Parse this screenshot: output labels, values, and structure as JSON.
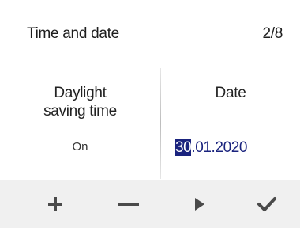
{
  "header": {
    "title": "Time and date",
    "page": "2/8"
  },
  "fields": {
    "dst": {
      "label_line1": "Daylight",
      "label_line2": "saving time",
      "value": "On"
    },
    "date": {
      "label": "Date",
      "value_selected": "30",
      "value_rest": ".01.2020"
    }
  },
  "toolbar": {
    "buttons": [
      {
        "icon": "plus-icon"
      },
      {
        "icon": "minus-icon"
      },
      {
        "icon": "play-arrow-icon"
      },
      {
        "icon": "checkmark-icon"
      }
    ]
  },
  "colors": {
    "accent": "#1a237e",
    "toolbar_bg": "#f0f0f0",
    "icon": "#4a4a4a"
  }
}
